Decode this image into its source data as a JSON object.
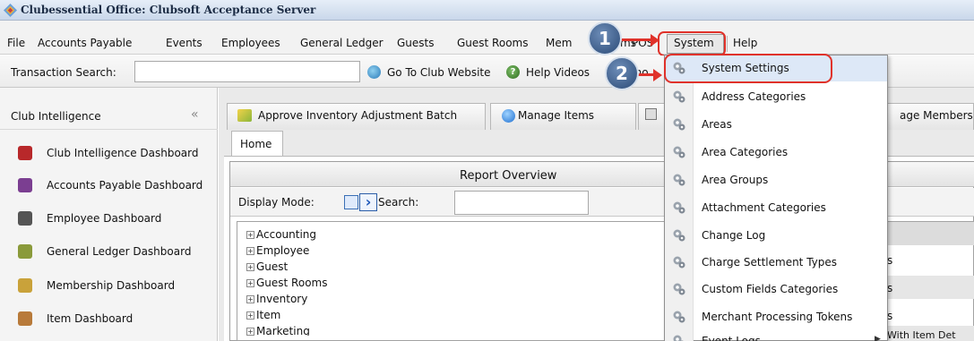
{
  "window": {
    "title": "Clubessential Office: Clubsoft Acceptance Server"
  },
  "menu": {
    "items": [
      "File",
      "Accounts Payable",
      "Events",
      "Employees",
      "General Ledger",
      "Guests",
      "Guest Rooms",
      "Mem",
      "ms",
      "POS",
      "System",
      "Help"
    ]
  },
  "toolbar": {
    "transaction_search_label": "Transaction Search:",
    "transaction_search_value": "",
    "go_to_club_website": "Go To Club Website",
    "help_videos": "Help Videos",
    "partial_item": "nno"
  },
  "left_panel": {
    "header": "Club Intelligence",
    "collapse_glyph": "«",
    "items": [
      {
        "label": "Club Intelligence Dashboard",
        "icon": "club-intelligence-icon",
        "color": "#b8282a"
      },
      {
        "label": "Accounts Payable Dashboard",
        "icon": "accounts-payable-icon",
        "color": "#7b3e91"
      },
      {
        "label": "Employee Dashboard",
        "icon": "employee-icon",
        "color": "#555555"
      },
      {
        "label": "General Ledger Dashboard",
        "icon": "ledger-icon",
        "color": "#8a9a3a"
      },
      {
        "label": "Membership Dashboard",
        "icon": "membership-icon",
        "color": "#c9a23a"
      },
      {
        "label": "Item Dashboard",
        "icon": "item-icon",
        "color": "#b87a3a"
      }
    ]
  },
  "doc_tabs": {
    "approve": "Approve Inventory Adjustment Batch",
    "manage_items": "Manage Items",
    "manage_members_partial": "age Members",
    "home": "Home"
  },
  "report": {
    "title": "Report Overview",
    "display_mode_label": "Display Mode:",
    "search_label": "Search:",
    "search_value": "",
    "tree": [
      "Accounting",
      "Employee",
      "Guest",
      "Guest Rooms",
      "Inventory",
      "Item",
      "Marketing"
    ],
    "right_fragments": [
      "s",
      "s",
      "s",
      "With Item Det"
    ]
  },
  "system_menu": {
    "items": [
      "System Settings",
      "Address Categories",
      "Areas",
      "Area Categories",
      "Area Groups",
      "Attachment Categories",
      "Change Log",
      "Charge Settlement Types",
      "Custom Fields Categories",
      "Merchant Processing Tokens",
      "Event Logs"
    ],
    "submenu_arrow": "▶"
  },
  "callouts": {
    "one": "1",
    "two": "2"
  },
  "colors": {
    "highlight_red": "#e0322a",
    "callout_blue": "#2b4a76"
  }
}
